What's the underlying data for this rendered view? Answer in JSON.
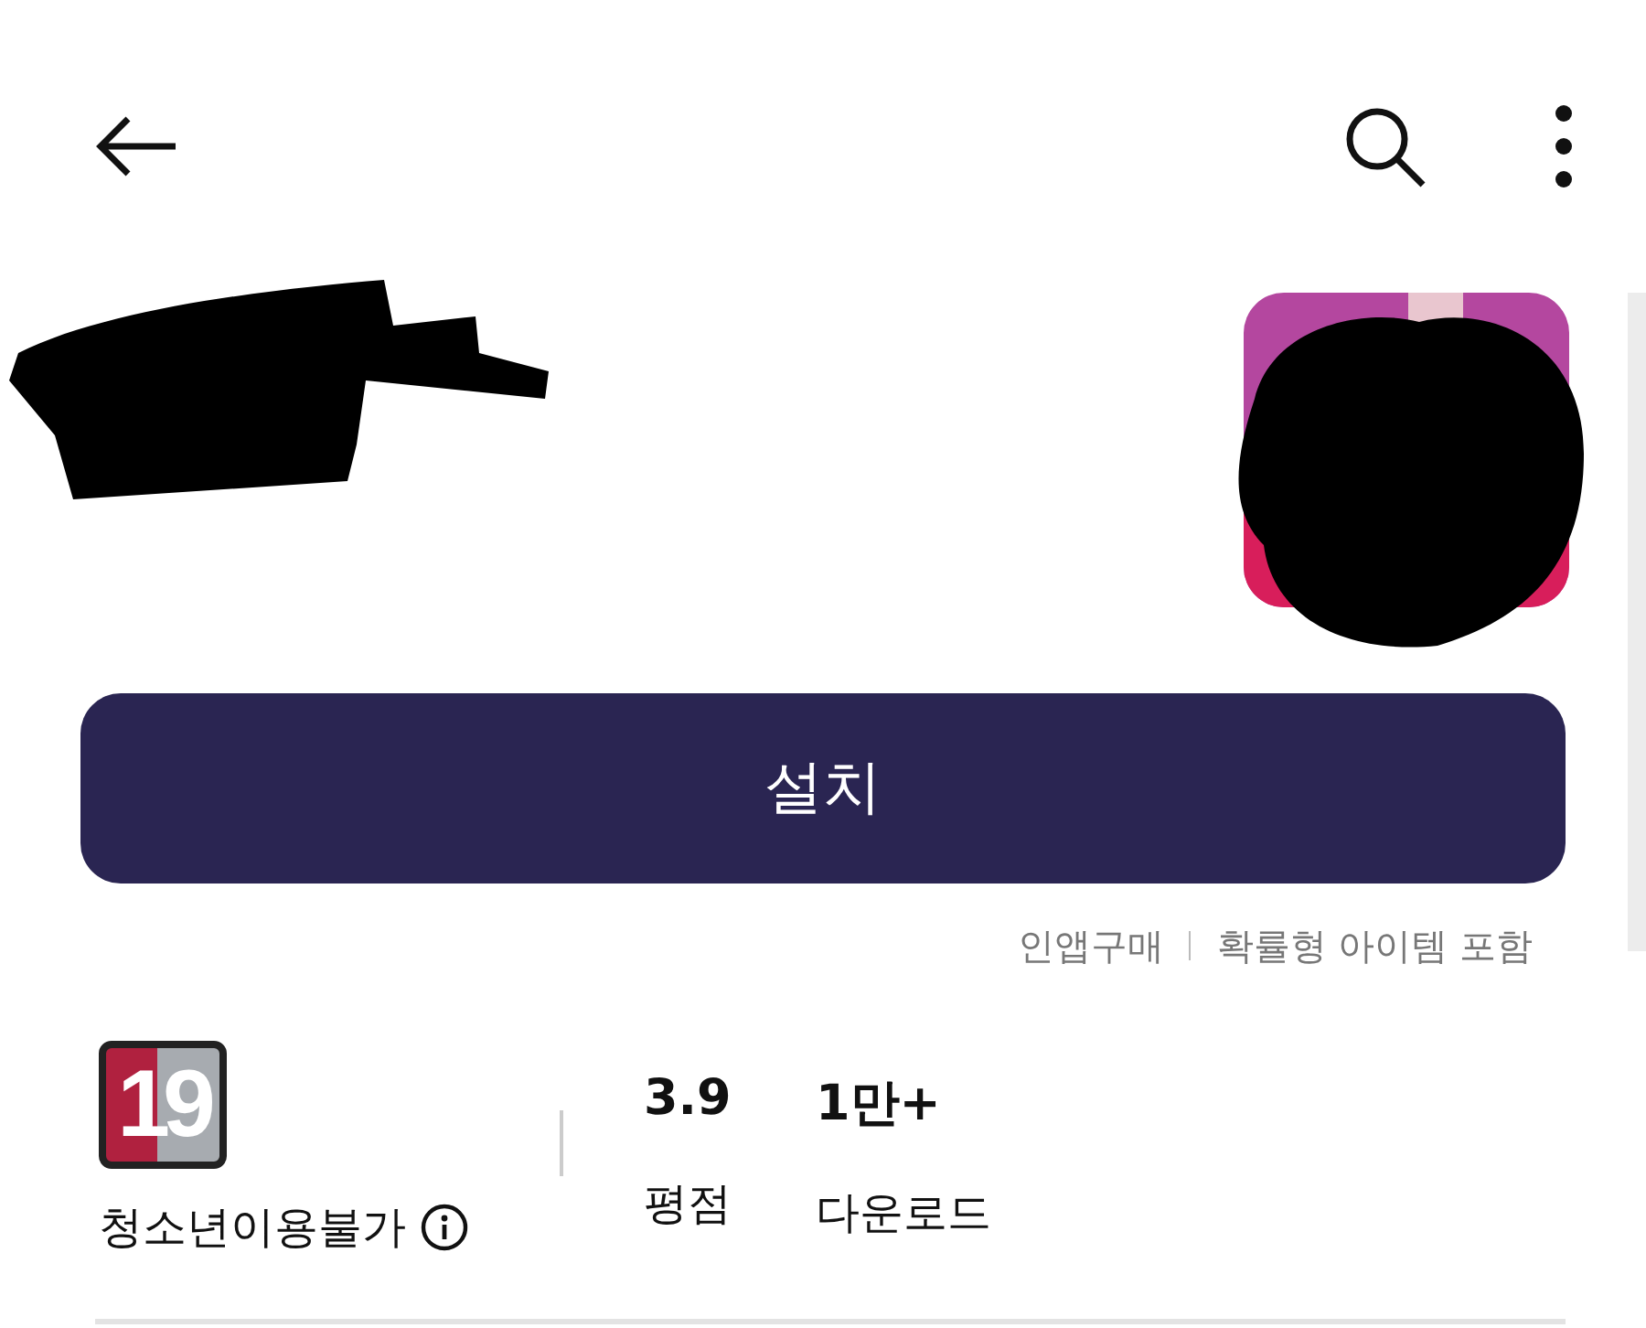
{
  "install_button": {
    "label": "설치"
  },
  "purchase_notes": [
    "인앱구매",
    "확률형 아이템 포함"
  ],
  "content_rating": {
    "badge": "19",
    "label": "청소년이용불가"
  },
  "stats": [
    {
      "value": "3.9",
      "label": "평점"
    },
    {
      "value": "1만+",
      "label": "다운로드"
    }
  ]
}
